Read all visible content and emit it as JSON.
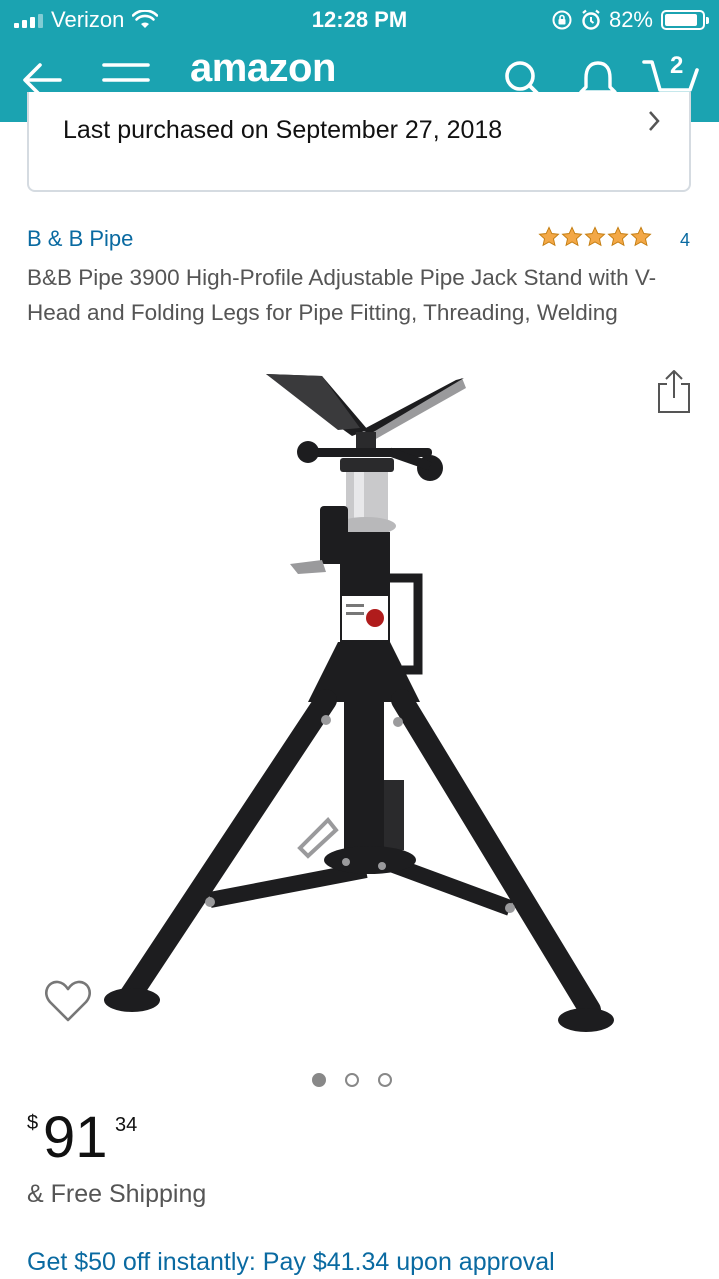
{
  "status_bar": {
    "carrier": "Verizon",
    "time": "12:28 PM",
    "battery": "82%",
    "battery_level": 0.82
  },
  "nav": {
    "logo": "amazon",
    "cart_count": "2",
    "icons": [
      "back-arrow-icon",
      "hamburger-menu-icon",
      "search-icon",
      "bell-icon",
      "cart-icon"
    ]
  },
  "purchase": {
    "text": "Last purchased on September 27, 2018"
  },
  "product": {
    "brand": "B & B Pipe",
    "rating_stars": 5,
    "rating_count": "4",
    "title": "B&B Pipe 3900 High-Profile Adjustable Pipe Jack Stand with V-Head and Folding Legs for Pipe Fitting, Threading, Welding",
    "image_count": 3,
    "active_image": 0
  },
  "price": {
    "symbol": "$",
    "whole": "91",
    "fraction": "34"
  },
  "shipping": "& Free Shipping",
  "promo": "Get $50 off instantly: Pay $41.34 upon approval",
  "colors": {
    "header": "#1ba3b1",
    "link": "#0a6aa1",
    "star": "#f3a847"
  }
}
